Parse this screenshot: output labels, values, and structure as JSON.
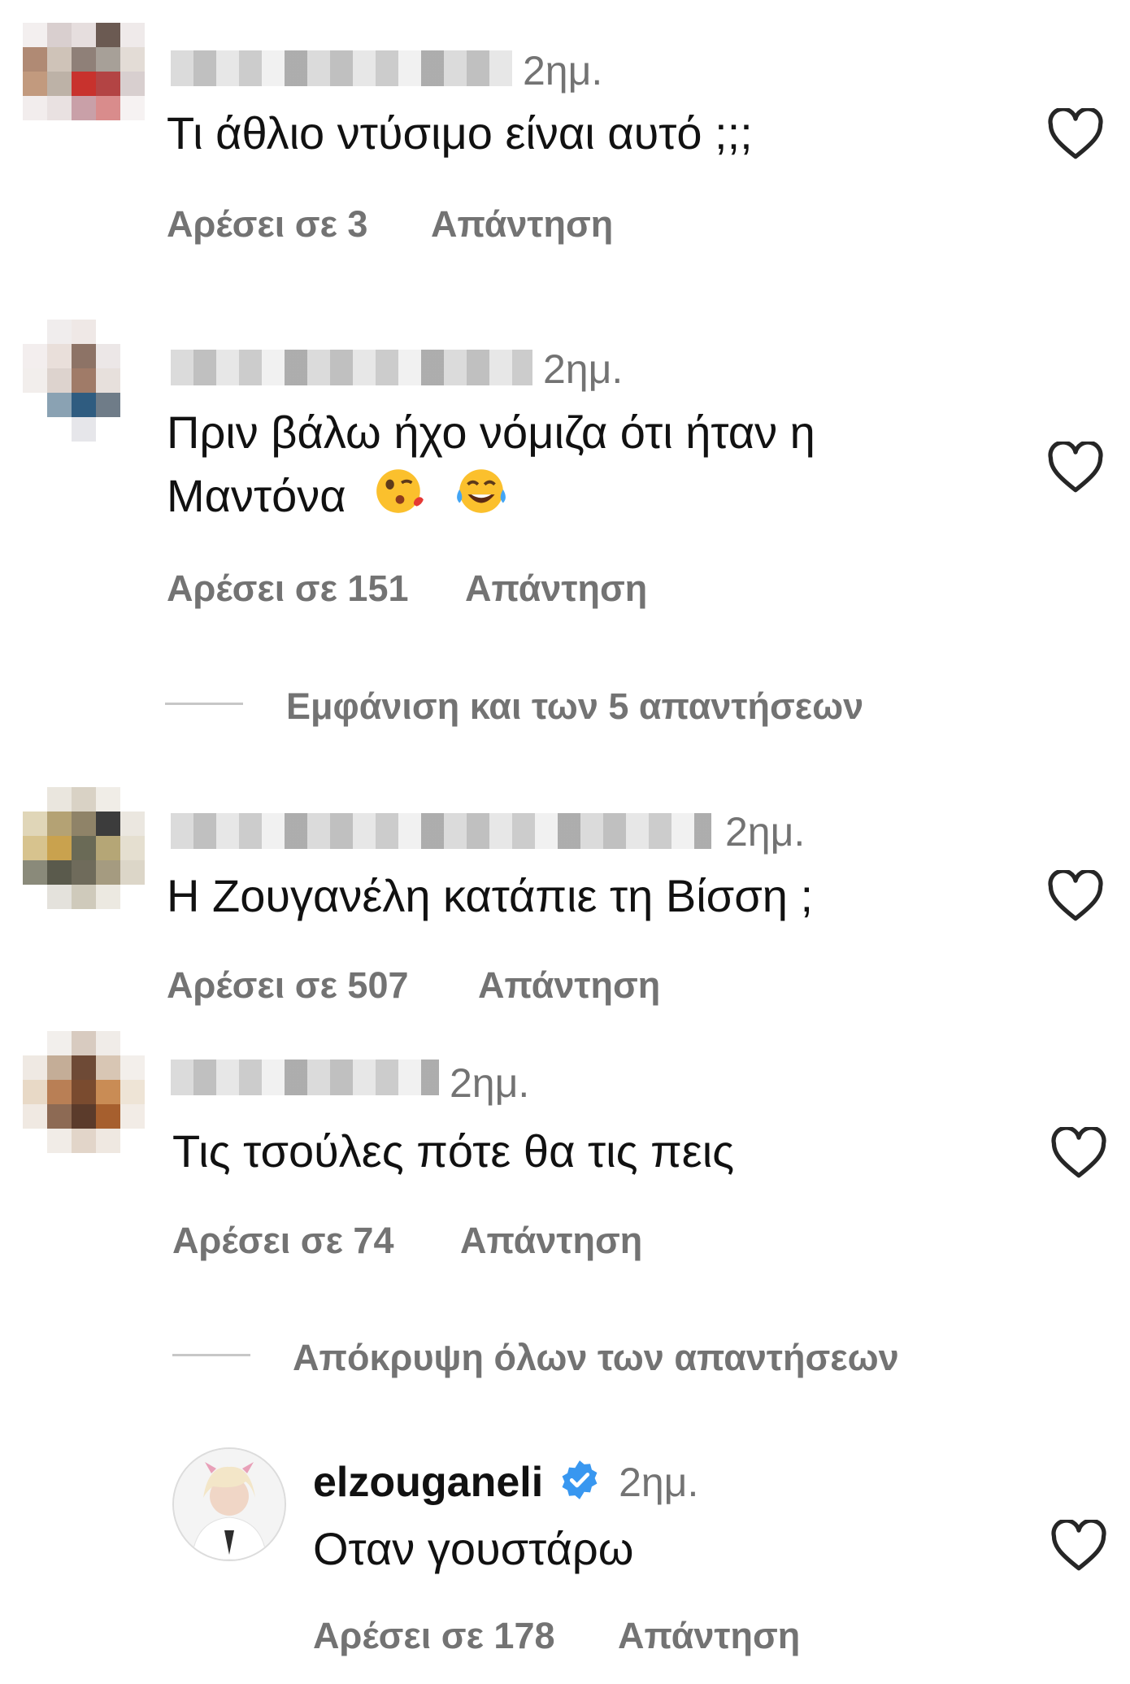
{
  "comments": [
    {
      "time": "2ημ.",
      "text": "Τι άθλιο ντύσιμο είναι αυτό ;;;",
      "likes": "Αρέσει σε 3",
      "reply": "Απάντηση"
    },
    {
      "time": "2ημ.",
      "text_line1": "Πριν βάλω ήχο νόμιζα ότι ήταν η",
      "text_line2": "Μαντόνα",
      "likes": "Αρέσει σε 151",
      "reply": "Απάντηση",
      "emojis": [
        "kissing-face-emoji",
        "tears-of-joy-emoji"
      ]
    },
    {
      "time": "2ημ.",
      "text": "Η Ζουγανέλη κατάπιε τη Βίσση ;",
      "likes": "Αρέσει σε 507",
      "reply": "Απάντηση"
    },
    {
      "time": "2ημ.",
      "text": "Τις τσούλες πότε θα τις πεις",
      "likes": "Αρέσει σε 74",
      "reply": "Απάντηση"
    }
  ],
  "view_replies": "Εμφάνιση και των 5 απαντήσεων",
  "hide_replies": "Απόκρυψη όλων των απαντήσεων",
  "reply_comment": {
    "username": "elzouganeli",
    "verified": true,
    "time": "2ημ.",
    "text": "Οταν γουστάρω",
    "likes": "Αρέσει σε 178",
    "reply": "Απάντηση"
  },
  "colors": {
    "text": "#111111",
    "muted": "#737373",
    "verified_blue": "#3897f0",
    "divider": "#c7c7c7"
  }
}
